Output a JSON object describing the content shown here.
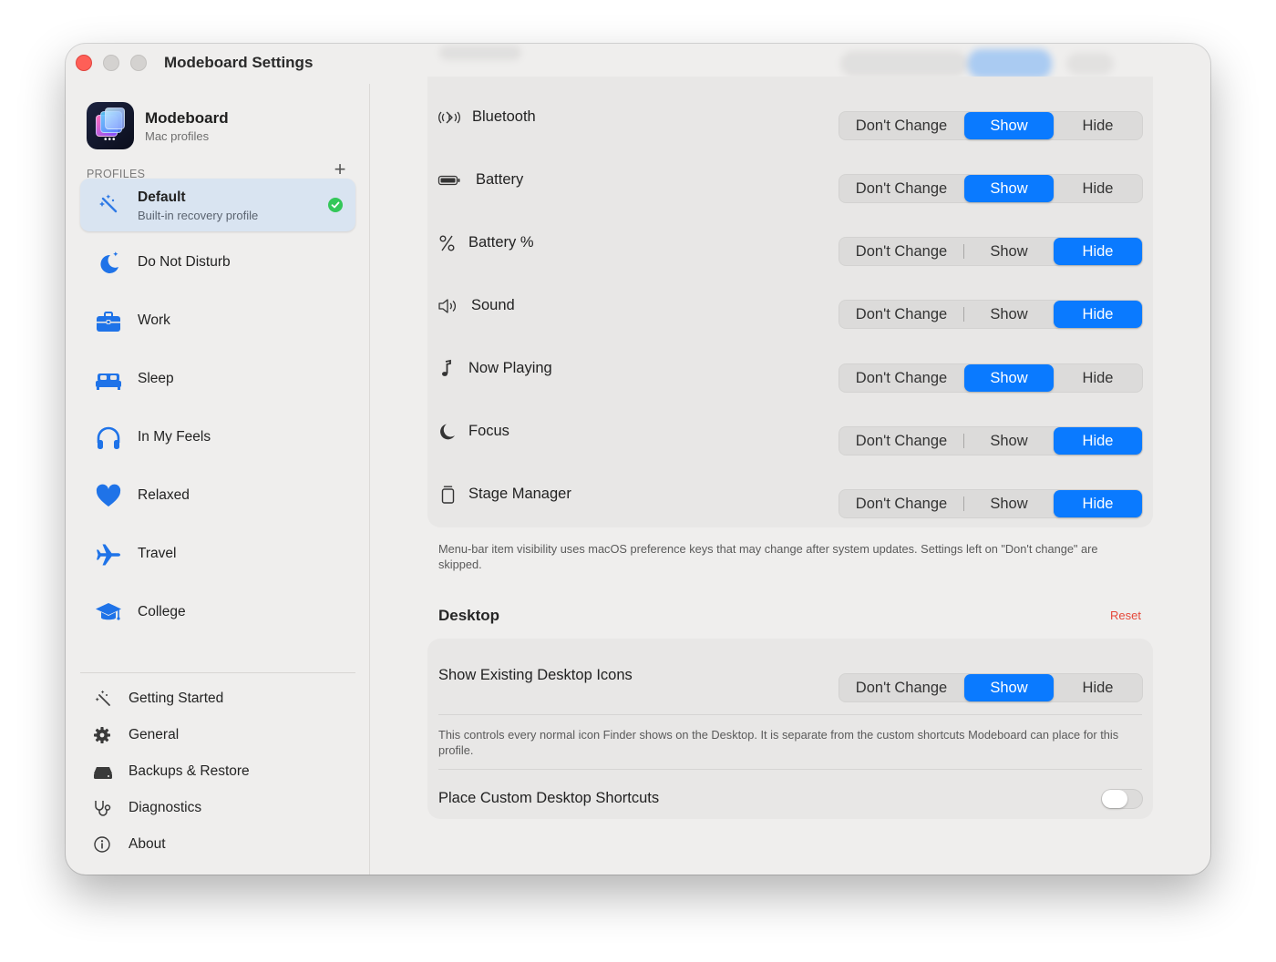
{
  "window": {
    "title": "Modeboard Settings"
  },
  "app": {
    "name": "Modeboard",
    "subtitle": "Mac profiles"
  },
  "sidebar": {
    "profiles_header": "PROFILES",
    "add_symbol": "+",
    "profiles": [
      {
        "name": "Default",
        "subtitle": "Built-in recovery profile",
        "icon": "magic-wand-icon",
        "selected": true,
        "active": true
      },
      {
        "name": "Do Not Disturb",
        "icon": "moon-icon"
      },
      {
        "name": "Work",
        "icon": "briefcase-icon"
      },
      {
        "name": "Sleep",
        "icon": "bed-icon"
      },
      {
        "name": "In My Feels",
        "icon": "headphones-icon"
      },
      {
        "name": "Relaxed",
        "icon": "heart-icon"
      },
      {
        "name": "Travel",
        "icon": "airplane-icon"
      },
      {
        "name": "College",
        "icon": "graduation-cap-icon"
      }
    ],
    "utilities": [
      {
        "label": "Getting Started",
        "icon": "sparkle-wand-icon"
      },
      {
        "label": "General",
        "icon": "gear-icon"
      },
      {
        "label": "Backups & Restore",
        "icon": "drive-icon"
      },
      {
        "label": "Diagnostics",
        "icon": "stethoscope-icon"
      },
      {
        "label": "About",
        "icon": "info-icon"
      }
    ]
  },
  "options": {
    "dont_change": "Don't Change",
    "show": "Show",
    "hide": "Hide"
  },
  "menubar": {
    "items": [
      {
        "label": "Bluetooth",
        "icon": "bluetooth-icon",
        "value": "Show"
      },
      {
        "label": "Battery",
        "icon": "battery-icon",
        "value": "Show"
      },
      {
        "label": "Battery %",
        "icon": "percent-icon",
        "value": "Hide"
      },
      {
        "label": "Sound",
        "icon": "speaker-icon",
        "value": "Hide"
      },
      {
        "label": "Now Playing",
        "icon": "music-note-icon",
        "value": "Show"
      },
      {
        "label": "Focus",
        "icon": "moon-icon",
        "value": "Hide"
      },
      {
        "label": "Stage Manager",
        "icon": "stage-manager-icon",
        "value": "Hide"
      }
    ],
    "note": "Menu-bar item visibility uses macOS preference keys that may change after system updates. Settings left on \"Don't change\" are skipped."
  },
  "desktop": {
    "title": "Desktop",
    "reset": "Reset",
    "show_icons_label": "Show Existing Desktop Icons",
    "show_icons_value": "Show",
    "show_icons_note": "This controls every normal icon Finder shows on the Desktop. It is separate from the custom shortcuts Modeboard can place for this profile.",
    "shortcuts_label": "Place Custom Desktop Shortcuts",
    "shortcuts_enabled": false
  },
  "colors": {
    "accent": "#0a7aff",
    "reset": "#e5483a",
    "check": "#34c759"
  }
}
